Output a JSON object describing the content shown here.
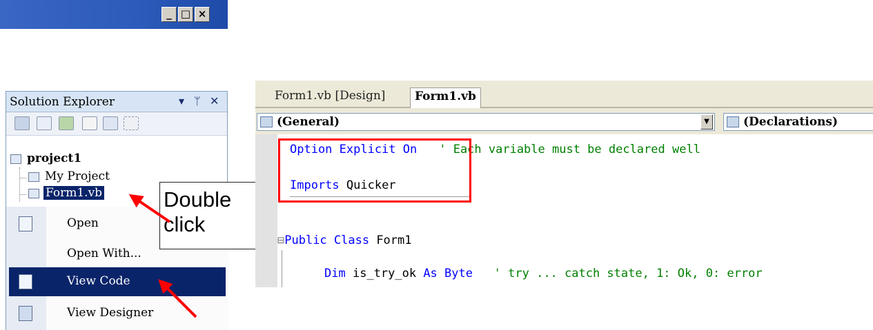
{
  "window": {
    "title_buttons": [
      "_",
      "□",
      "×"
    ]
  },
  "solution_explorer": {
    "title": "Solution Explorer",
    "header_icons": [
      "dropdown-arrow-icon",
      "pin-icon",
      "close-icon"
    ],
    "toolbar_icons": [
      "properties-icon",
      "show-all-files-icon",
      "refresh-icon",
      "view-code-icon",
      "view-designer-icon",
      "class-diagram-icon"
    ],
    "tree": {
      "project": "project1",
      "items": [
        "My Project",
        "Form1.vb"
      ]
    }
  },
  "context_menu": {
    "items": [
      {
        "label": "Open",
        "icon": "open-file-icon"
      },
      {
        "label": "Open With...",
        "icon": ""
      },
      {
        "label": "View Code",
        "icon": "view-code-icon",
        "selected": true
      },
      {
        "label": "View Designer",
        "icon": "view-designer-icon"
      }
    ]
  },
  "callout": {
    "line1": "Double",
    "line2": "click"
  },
  "editor": {
    "tabs": [
      "Form1.vb [Design]",
      "Form1.vb"
    ],
    "active_tab": "Form1.vb",
    "left_dropdown": "(General)",
    "right_dropdown": "(Declarations)",
    "code": {
      "line1_kw": "Option Explicit On",
      "line1_comment": "' Each variable must be declared well",
      "line2_kw": "Imports",
      "line2_txt": " Quicker",
      "line3_prefix": "⊟",
      "line3_kw": "Public Class",
      "line3_txt": " Form1",
      "line4_kw1": "Dim",
      "line4_txt1": " is_try_ok ",
      "line4_kw2": "As Byte",
      "line4_comment": "   ' try ... catch state, 1: Ok, 0: error"
    }
  },
  "colors": {
    "keyword": "#0000ff",
    "comment": "#008000",
    "highlight_box": "#ff0000",
    "arrow": "#ff0000",
    "menu_selected": "#0a246a"
  }
}
